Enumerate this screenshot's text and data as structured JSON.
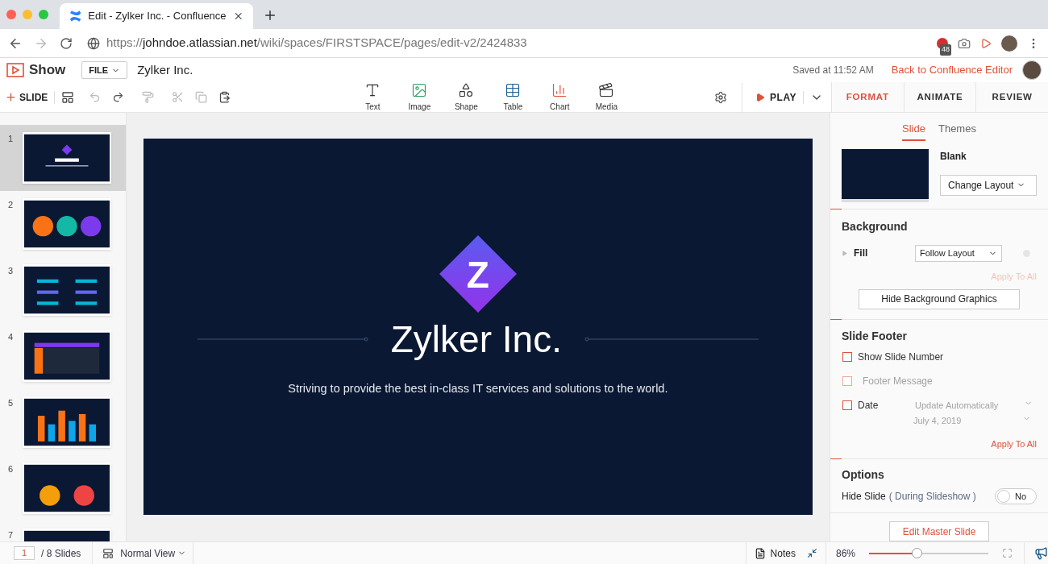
{
  "browser": {
    "tab_title": "Edit - Zylker Inc. - Confluence",
    "url_scheme": "https://",
    "url_host": "johndoe.atlassian.net",
    "url_path": "/wiki/spaces/FIRSTSPACE/pages/edit-v2/2424833",
    "extension_badge": "48"
  },
  "header": {
    "logo_text": "Show",
    "file_menu": "FILE",
    "doc_title": "Zylker Inc.",
    "saved": "Saved at 11:52 AM",
    "back_link": "Back to Confluence Editor"
  },
  "toolbar": {
    "slide_button": "SLIDE",
    "insert": [
      {
        "kind": "text",
        "label": "Text"
      },
      {
        "kind": "image",
        "label": "Image"
      },
      {
        "kind": "shape",
        "label": "Shape"
      },
      {
        "kind": "table",
        "label": "Table"
      },
      {
        "kind": "chart",
        "label": "Chart"
      },
      {
        "kind": "media",
        "label": "Media"
      }
    ],
    "play": "PLAY"
  },
  "slides": [
    {
      "number": "1",
      "kind": "title",
      "selected": true
    },
    {
      "number": "2",
      "kind": "circles",
      "selected": false
    },
    {
      "number": "3",
      "kind": "strategy",
      "selected": false
    },
    {
      "number": "4",
      "kind": "table",
      "selected": false
    },
    {
      "number": "5",
      "kind": "bars",
      "selected": false
    },
    {
      "number": "6",
      "kind": "pies",
      "selected": false
    },
    {
      "number": "7",
      "kind": "partial",
      "selected": false
    }
  ],
  "slide": {
    "logo_letter": "Z",
    "title": "Zylker Inc.",
    "subtitle": "Striving to provide the best in-class IT services and solutions to the world."
  },
  "panel": {
    "tabs": [
      {
        "label": "FORMAT",
        "selected": true
      },
      {
        "label": "ANIMATE",
        "selected": false
      },
      {
        "label": "REVIEW",
        "selected": false
      }
    ],
    "subtabs": [
      {
        "label": "Slide",
        "selected": true
      },
      {
        "label": "Themes",
        "selected": false
      }
    ],
    "layout_name": "Blank",
    "change_layout": "Change Layout",
    "background": {
      "heading": "Background",
      "fill_label": "Fill",
      "fill_value": "Follow Layout",
      "apply": {
        "label": "Apply To All",
        "disabled": true
      },
      "hide_button": "Hide Background Graphics"
    },
    "footer": {
      "heading": "Slide Footer",
      "rows": [
        {
          "label": "Show Slide Number",
          "checked": false,
          "disabled": false
        },
        {
          "label": "Footer Message",
          "checked": false,
          "disabled": true
        },
        {
          "label": "Date",
          "checked": false,
          "disabled": false
        }
      ],
      "date_mode": "Update Automatically",
      "date_value": "July 4, 2019",
      "apply": {
        "label": "Apply To All",
        "disabled": false
      }
    },
    "options": {
      "heading": "Options",
      "hide_label": "Hide Slide",
      "hide_note": "( During Slideshow )",
      "toggle": {
        "label": "No",
        "on": false
      }
    },
    "edit_master": "Edit Master Slide"
  },
  "status": {
    "page": "1",
    "total": "/ 8 Slides",
    "view": "Normal View",
    "notes": "Notes",
    "zoom": "86%",
    "zoom_level": {
      "level": 0.4
    }
  }
}
